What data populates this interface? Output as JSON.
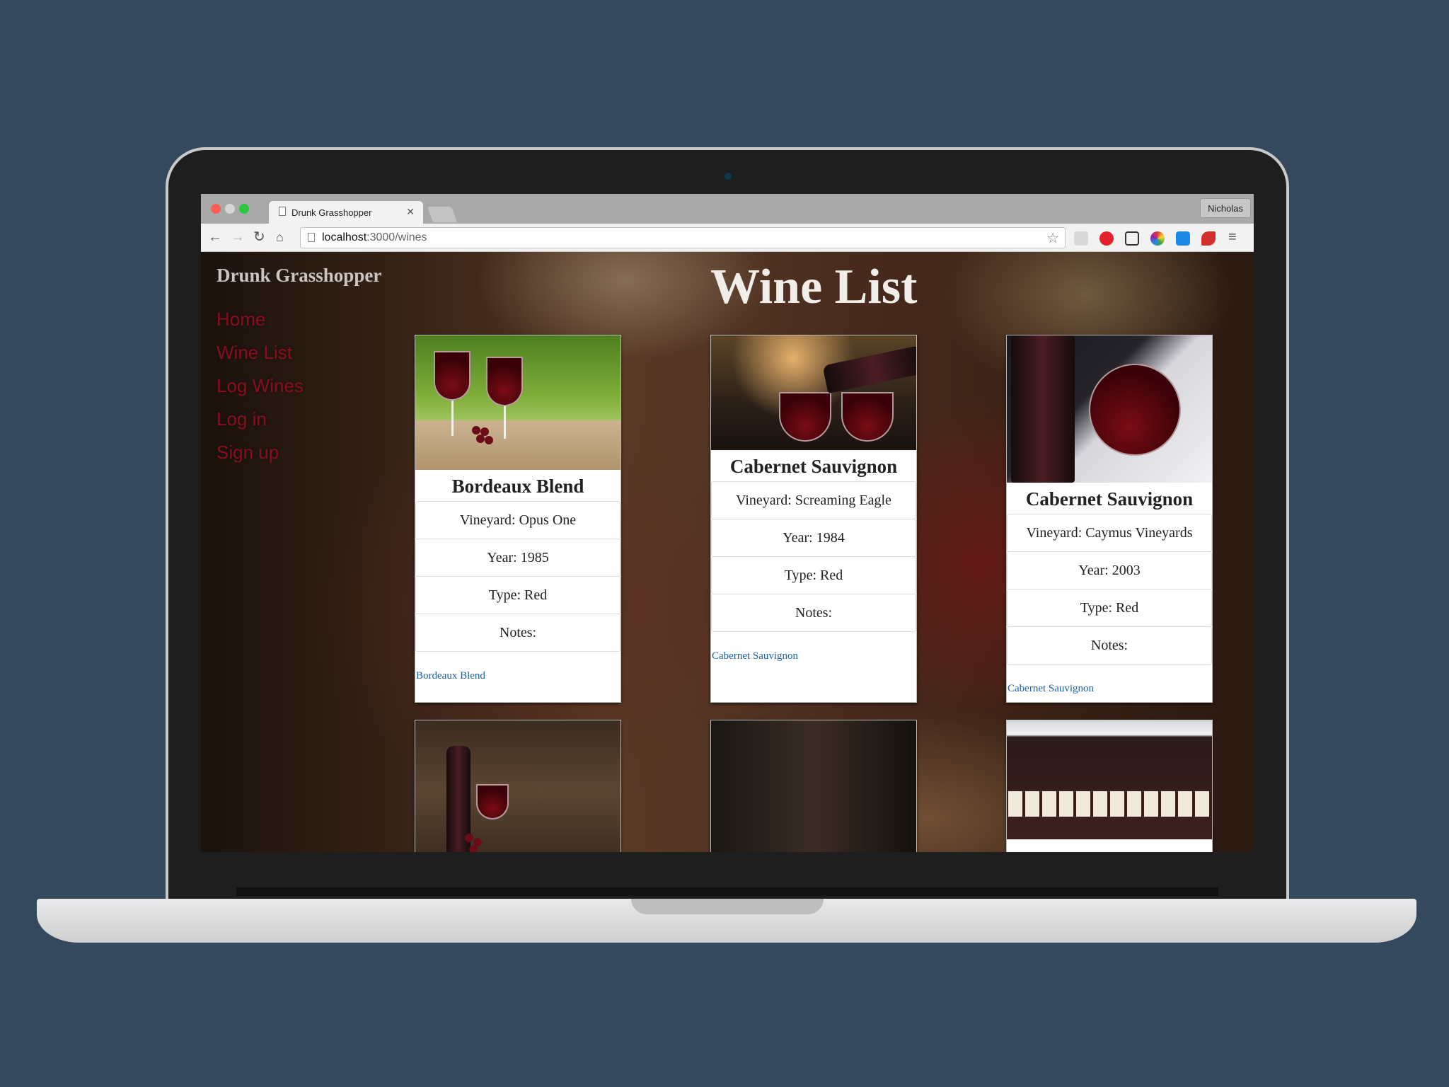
{
  "browser": {
    "tab_title": "Drunk Grasshopper",
    "profile_name": "Nicholas",
    "url_host": "localhost",
    "url_path": ":3000/wines"
  },
  "site": {
    "brand": "Drunk Grasshopper",
    "nav": [
      "Home",
      "Wine List",
      "Log Wines",
      "Log in",
      "Sign up"
    ],
    "page_title": "Wine List"
  },
  "wines": [
    {
      "name": "Bordeaux Blend",
      "vineyard": "Vineyard: Opus One",
      "year": "Year: 1985",
      "type": "Type: Red",
      "notes": "Notes:",
      "link": "Bordeaux Blend"
    },
    {
      "name": "Cabernet Sauvignon",
      "vineyard": "Vineyard: Screaming Eagle",
      "year": "Year: 1984",
      "type": "Type: Red",
      "notes": "Notes:",
      "link": "Cabernet Sauvignon"
    },
    {
      "name": "Cabernet Sauvignon",
      "vineyard": "Vineyard: Caymus Vineyards",
      "year": "Year: 2003",
      "type": "Type: Red",
      "notes": "Notes:",
      "link": "Cabernet Sauvignon"
    }
  ],
  "colors": {
    "background": "#34495e",
    "nav_link": "#8b0e1f",
    "card_link": "#1a61a8"
  }
}
